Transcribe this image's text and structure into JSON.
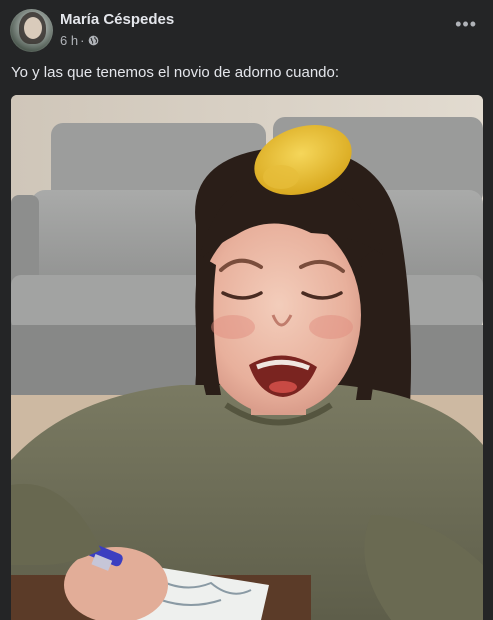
{
  "post": {
    "author": "María Céspedes",
    "time": "6 h",
    "separator": "·",
    "privacy_icon": "globe-icon",
    "more_icon": "more-options-icon",
    "more_label": "•••",
    "caption": "Yo y las que tenemos el novio de adorno cuando:",
    "image_icon": "crying-girl-photo"
  },
  "colors": {
    "background": "#242526",
    "text_primary": "#e4e6eb",
    "text_secondary": "#b0b3b8"
  }
}
